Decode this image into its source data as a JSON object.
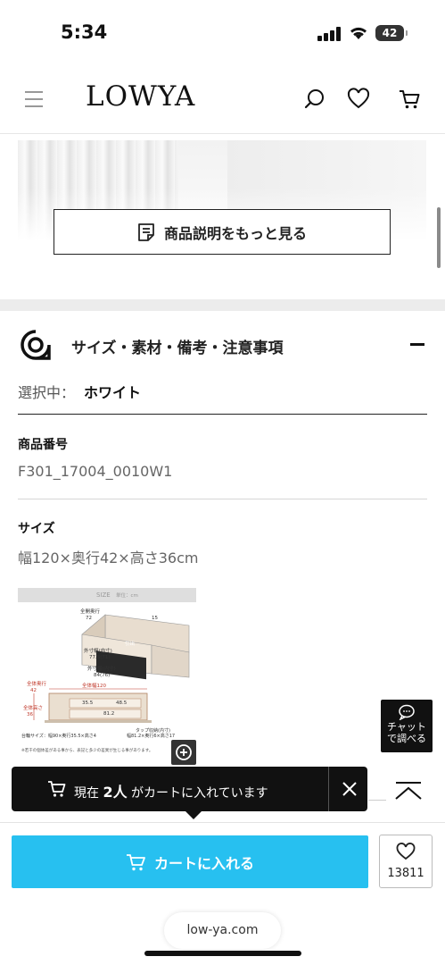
{
  "status_bar": {
    "time": "5:34",
    "battery": "42"
  },
  "header": {
    "logo": "LOWYA"
  },
  "description": {
    "more_button": "商品説明をもっと見る"
  },
  "spec_section": {
    "title": "サイズ・素材・備考・注意事項",
    "selected_label": "選択中：",
    "selected_value": "ホワイト",
    "product_number_label": "商品番号",
    "product_number": "F301_17004_0010W1",
    "size_label": "サイズ",
    "size_value": "幅120×奥行42×高さ36cm"
  },
  "size_diagram": {
    "title": "SIZE",
    "unit": "単位：cm",
    "labels": [
      "全開奥行",
      "72",
      "15",
      "引出",
      "外寸幅(内寸)",
      "77.5(71)",
      "外寸幅(内寸)",
      "84(76)",
      "全体奥行",
      "42",
      "全体幅120",
      "全体高さ",
      "36",
      "35.5",
      "48.5",
      "81.2",
      "台輪サイズ：幅90×奥行35.5×高さ4",
      "タップ収納(内寸)",
      "幅81.2×奥行6×高さ17",
      "※若干の個体差がある事から、表記と多少の差異が生じる事があります。"
    ]
  },
  "chat": {
    "line1": "チャット",
    "line2": "で調べる"
  },
  "toast": {
    "prefix": "現在",
    "count": "2人",
    "suffix": "がカートに入れています"
  },
  "cta": {
    "cart_label": "カートに入れる",
    "favorite_count": "13811"
  },
  "browser": {
    "url": "low-ya.com"
  },
  "colors": {
    "cart_button": "#27c0f0",
    "toast_bg": "#111111"
  }
}
